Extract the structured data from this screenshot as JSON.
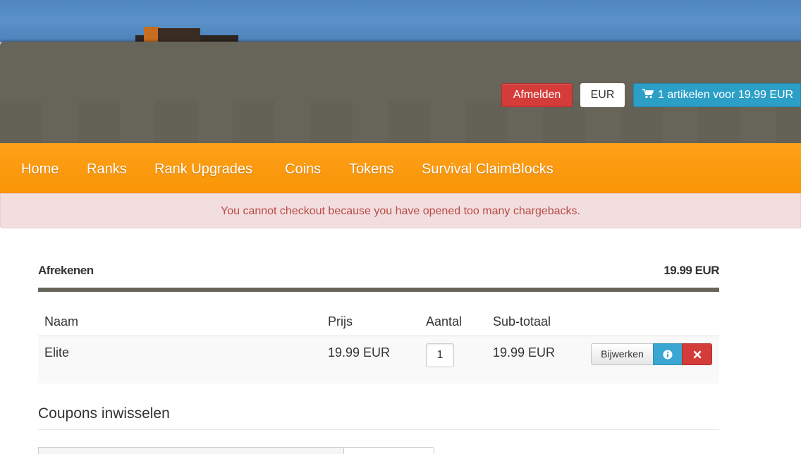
{
  "header": {
    "logout_label": "Afmelden",
    "currency": "EUR",
    "cart_label": "1 artikelen voor 19.99 EUR"
  },
  "nav": {
    "items": [
      "Home",
      "Ranks",
      "Rank Upgrades",
      "Coins",
      "Tokens",
      "Survival ClaimBlocks"
    ]
  },
  "alert": {
    "message": "You cannot checkout because you have opened too many chargebacks."
  },
  "checkout": {
    "title": "Afrekenen",
    "total": "19.99 EUR",
    "columns": [
      "Naam",
      "Prijs",
      "Aantal",
      "Sub-totaal"
    ],
    "rows": [
      {
        "name": "Elite",
        "price": "19.99 EUR",
        "quantity": "1",
        "subtotal": "19.99 EUR"
      }
    ],
    "update_label": "Bijwerken"
  },
  "coupons": {
    "title": "Coupons inwisselen"
  },
  "colors": {
    "nav_orange": "#fea019",
    "header_gray": "#67645a",
    "danger_red": "#d43c3a",
    "info_blue": "#2c9fc7",
    "alert_bg": "#f2dede",
    "alert_text": "#b94a48"
  },
  "icons": {
    "cart": "shopping-cart-icon",
    "info": "info-circle-icon",
    "remove": "close-icon"
  }
}
